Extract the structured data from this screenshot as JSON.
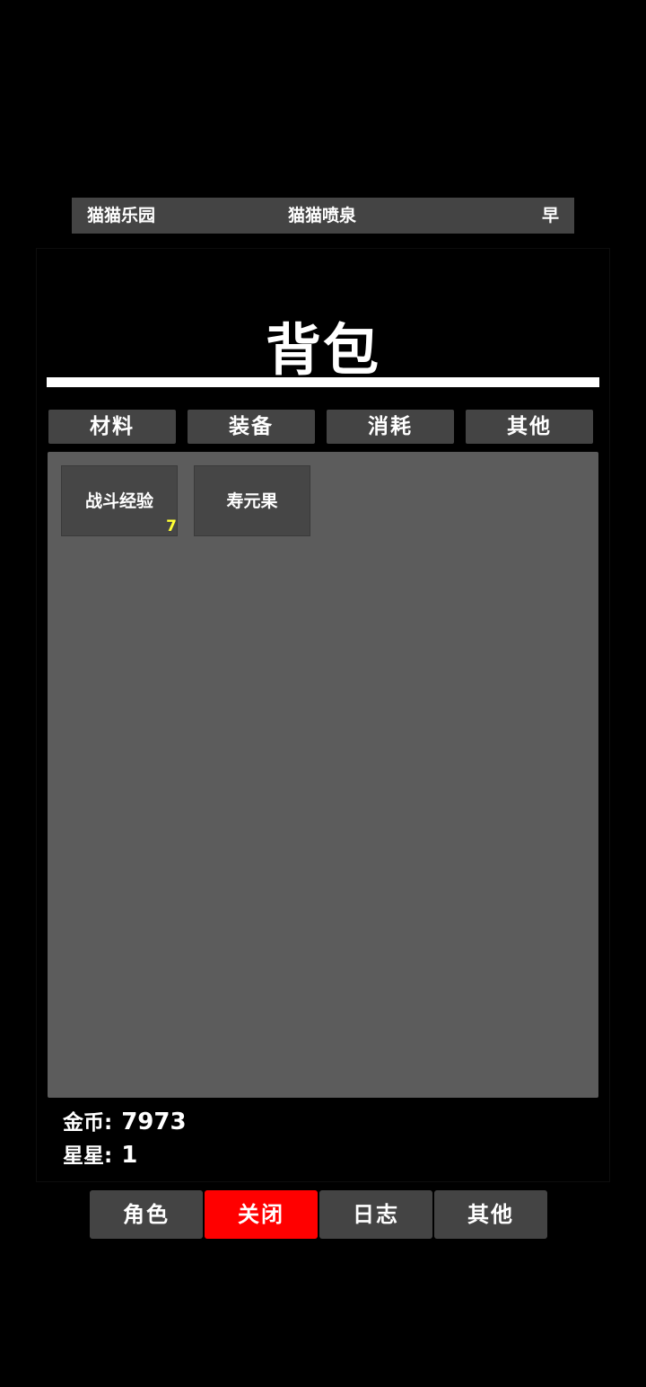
{
  "status_bar": {
    "region": "猫猫乐园",
    "location": "猫猫喷泉",
    "time_of_day": "早"
  },
  "panel": {
    "title": "背包",
    "tabs": [
      {
        "label": "材料"
      },
      {
        "label": "装备"
      },
      {
        "label": "消耗"
      },
      {
        "label": "其他"
      }
    ],
    "items": [
      {
        "name": "战斗经验",
        "count": "7"
      },
      {
        "name": "寿元果",
        "count": ""
      }
    ],
    "currency": {
      "gold_label": "金币:",
      "gold_value": "7973",
      "star_label": "星星:",
      "star_value": "1"
    }
  },
  "bottom_nav": [
    {
      "label": "角色"
    },
    {
      "label": "关闭"
    },
    {
      "label": "日志"
    },
    {
      "label": "其他"
    }
  ],
  "colors": {
    "background": "#000000",
    "button": "#444444",
    "inventory_area": "#5c5c5c",
    "close_button": "#ff0000",
    "count_text": "#ffff33"
  }
}
